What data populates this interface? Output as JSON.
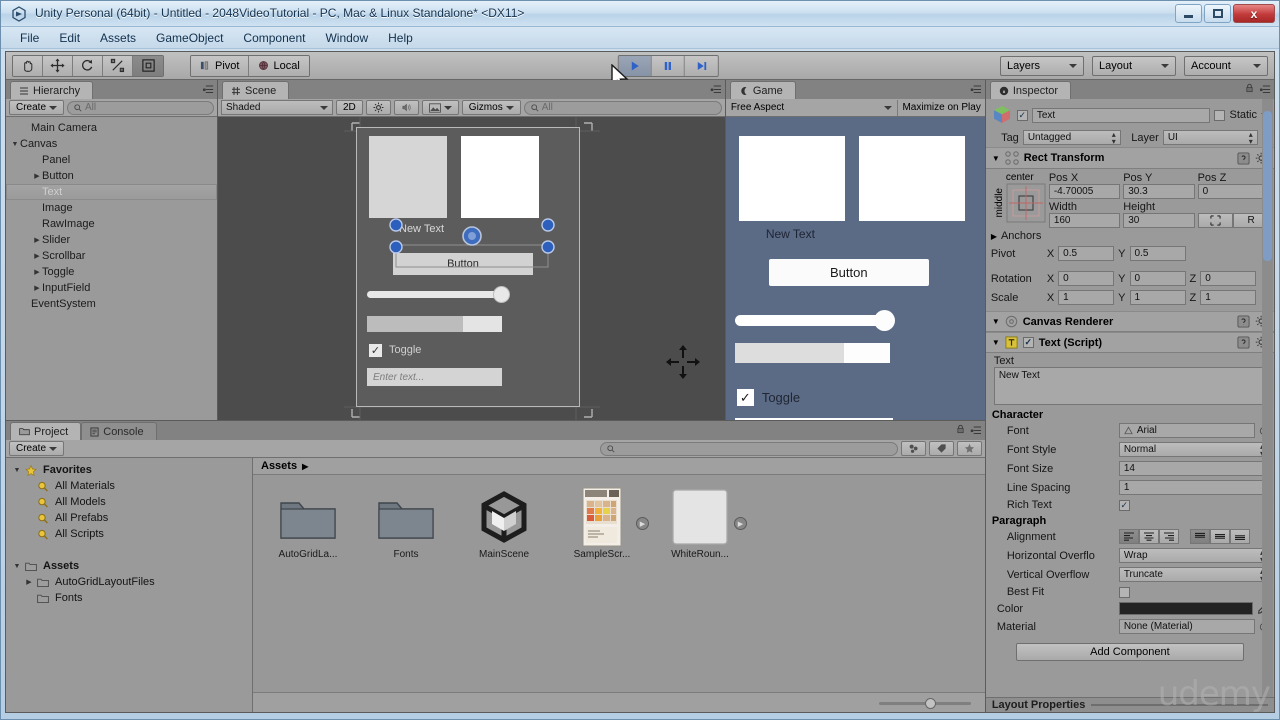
{
  "window": {
    "title": "Unity Personal (64bit) - Untitled - 2048VideoTutorial - PC, Mac & Linux Standalone* <DX11>",
    "minimize": "–",
    "maximize": "□",
    "close": "x"
  },
  "menu": {
    "items": [
      "File",
      "Edit",
      "Assets",
      "GameObject",
      "Component",
      "Window",
      "Help"
    ]
  },
  "toolbar": {
    "tools": [
      "hand-tool",
      "move-tool",
      "rotate-tool",
      "scale-tool",
      "rect-tool"
    ],
    "pivot_label": "Pivot",
    "local_label": "Local",
    "play_label": "Play",
    "pause_label": "Pause",
    "step_label": "Step",
    "layers_label": "Layers",
    "layout_label": "Layout",
    "account_label": "Account"
  },
  "hierarchy": {
    "tab": "Hierarchy",
    "create_label": "Create",
    "search_placeholder": "All",
    "items": [
      {
        "label": "Main Camera",
        "depth": 1,
        "arrow": "none",
        "selected": false
      },
      {
        "label": "Canvas",
        "depth": 0,
        "arrow": "open",
        "selected": false
      },
      {
        "label": "Panel",
        "depth": 2,
        "arrow": "none",
        "selected": false
      },
      {
        "label": "Button",
        "depth": 2,
        "arrow": "closed",
        "selected": false
      },
      {
        "label": "Text",
        "depth": 2,
        "arrow": "none",
        "selected": true
      },
      {
        "label": "Image",
        "depth": 2,
        "arrow": "none",
        "selected": false
      },
      {
        "label": "RawImage",
        "depth": 2,
        "arrow": "none",
        "selected": false
      },
      {
        "label": "Slider",
        "depth": 2,
        "arrow": "closed",
        "selected": false
      },
      {
        "label": "Scrollbar",
        "depth": 2,
        "arrow": "closed",
        "selected": false
      },
      {
        "label": "Toggle",
        "depth": 2,
        "arrow": "closed",
        "selected": false
      },
      {
        "label": "InputField",
        "depth": 2,
        "arrow": "closed",
        "selected": false
      },
      {
        "label": "EventSystem",
        "depth": 1,
        "arrow": "none",
        "selected": false
      }
    ]
  },
  "scene": {
    "tab": "Scene",
    "shading": "Shaded",
    "mode_2d": "2D",
    "gizmos_label": "Gizmos",
    "search_placeholder": "All"
  },
  "game": {
    "tab": "Game",
    "aspect": "Free Aspect",
    "maximize_label": "Maximize on Play",
    "text_label": "New Text",
    "button_label": "Button",
    "toggle_label": "Toggle",
    "input_placeholder": "Enter text...",
    "background_color": "#5b6b86"
  },
  "project": {
    "tab": "Project",
    "console_tab": "Console",
    "create_label": "Create",
    "search_placeholder": "",
    "breadcrumb": "Assets",
    "tree": [
      {
        "label": "Favorites",
        "depth": 0,
        "arrow": "open",
        "icon": "star-icon",
        "bold": true
      },
      {
        "label": "All Materials",
        "depth": 1,
        "arrow": "none",
        "icon": "search-icon",
        "bold": false
      },
      {
        "label": "All Models",
        "depth": 1,
        "arrow": "none",
        "icon": "search-icon",
        "bold": false
      },
      {
        "label": "All Prefabs",
        "depth": 1,
        "arrow": "none",
        "icon": "search-icon",
        "bold": false
      },
      {
        "label": "All Scripts",
        "depth": 1,
        "arrow": "none",
        "icon": "search-icon",
        "bold": false
      },
      {
        "label": "",
        "depth": 0,
        "arrow": "none",
        "icon": "none",
        "bold": false
      },
      {
        "label": "Assets",
        "depth": 0,
        "arrow": "open",
        "icon": "folder-icon",
        "bold": true
      },
      {
        "label": "AutoGridLayoutFiles",
        "depth": 1,
        "arrow": "closed",
        "icon": "folder-icon",
        "bold": false
      },
      {
        "label": "Fonts",
        "depth": 1,
        "arrow": "none",
        "icon": "folder-icon",
        "bold": false
      }
    ],
    "assets": [
      {
        "label": "AutoGridLa...",
        "type": "folder"
      },
      {
        "label": "Fonts",
        "type": "folder"
      },
      {
        "label": "MainScene",
        "type": "scene"
      },
      {
        "label": "SampleScr...",
        "type": "sprite"
      },
      {
        "label": "WhiteRoun...",
        "type": "sprite-white"
      }
    ]
  },
  "inspector": {
    "tab": "Inspector",
    "object_name": "Text",
    "static_label": "Static",
    "tag_label": "Tag",
    "tag_value": "Untagged",
    "layer_label": "Layer",
    "layer_value": "UI",
    "rect_transform": {
      "title": "Rect Transform",
      "anchor_preset_top": "center",
      "anchor_preset_left": "middle",
      "pos_x_label": "Pos X",
      "pos_x": "-4.70005",
      "pos_y_label": "Pos Y",
      "pos_y": "30.3",
      "pos_z_label": "Pos Z",
      "pos_z": "0",
      "width_label": "Width",
      "width": "160",
      "height_label": "Height",
      "height": "30",
      "blueprint_label": "",
      "raw_label": "R",
      "anchors_label": "Anchors",
      "pivot_label": "Pivot",
      "pivot_x": "0.5",
      "pivot_y": "0.5",
      "rotation_label": "Rotation",
      "rot_x": "0",
      "rot_y": "0",
      "rot_z": "0",
      "scale_label": "Scale",
      "scale_x": "1",
      "scale_y": "1",
      "scale_z": "1"
    },
    "canvas_renderer": {
      "title": "Canvas Renderer"
    },
    "text_script": {
      "title": "Text (Script)",
      "text_label": "Text",
      "text_value": "New Text",
      "character_header": "Character",
      "font_label": "Font",
      "font_value": "Arial",
      "font_style_label": "Font Style",
      "font_style_value": "Normal",
      "font_size_label": "Font Size",
      "font_size_value": "14",
      "line_spacing_label": "Line Spacing",
      "line_spacing_value": "1",
      "rich_text_label": "Rich Text",
      "paragraph_header": "Paragraph",
      "alignment_label": "Alignment",
      "horizontal_overflow_label": "Horizontal Overflo",
      "horizontal_overflow_value": "Wrap",
      "vertical_overflow_label": "Vertical Overflow",
      "vertical_overflow_value": "Truncate",
      "best_fit_label": "Best Fit",
      "color_label": "Color",
      "color_value": "#222222",
      "material_label": "Material",
      "material_value": "None (Material)"
    },
    "add_component_label": "Add Component",
    "layout_properties_label": "Layout Properties"
  },
  "watermark": "udemy"
}
